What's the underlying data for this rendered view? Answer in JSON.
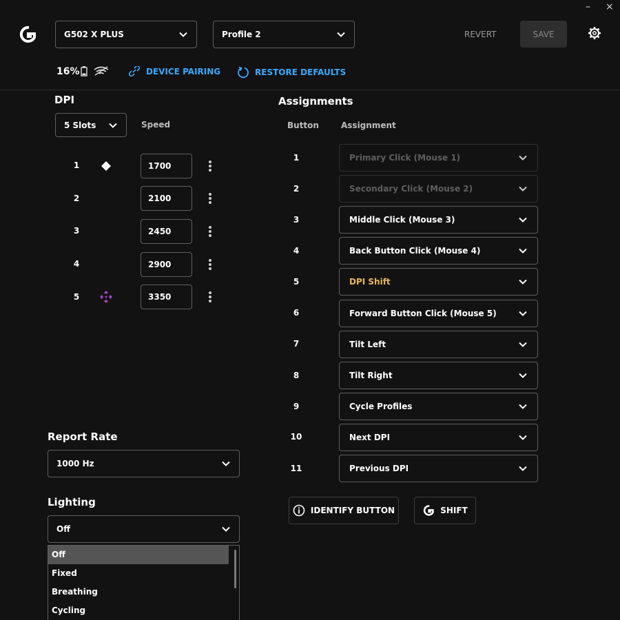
{
  "window": {
    "minimize_label": "–",
    "close_label": "×"
  },
  "header": {
    "device_name": "G502 X PLUS",
    "profile_name": "Profile 2",
    "revert_label": "REVERT",
    "save_label": "SAVE"
  },
  "status": {
    "battery_percent": "16%",
    "device_pairing_label": "DEVICE PAIRING",
    "restore_defaults_label": "RESTORE DEFAULTS"
  },
  "dpi": {
    "title": "DPI",
    "slots_label": "5 Slots",
    "speed_header": "Speed",
    "slots": [
      {
        "num": "1",
        "value": "1700",
        "marker": "default-dpi-diamond-icon"
      },
      {
        "num": "2",
        "value": "2100"
      },
      {
        "num": "3",
        "value": "2450"
      },
      {
        "num": "4",
        "value": "2900"
      },
      {
        "num": "5",
        "value": "3350",
        "marker": "shift-dpi-icon"
      }
    ]
  },
  "assignments": {
    "title": "Assignments",
    "button_header": "Button",
    "assignment_header": "Assignment",
    "rows": [
      {
        "num": "1",
        "label": "Primary Click (Mouse 1)",
        "state": "disabled"
      },
      {
        "num": "2",
        "label": "Secondary Click (Mouse 2)",
        "state": "disabled"
      },
      {
        "num": "3",
        "label": "Middle Click (Mouse 3)"
      },
      {
        "num": "4",
        "label": "Back Button Click (Mouse 4)"
      },
      {
        "num": "5",
        "label": "DPI Shift",
        "state": "highlight"
      },
      {
        "num": "6",
        "label": "Forward Button Click (Mouse 5)"
      },
      {
        "num": "7",
        "label": "Tilt Left"
      },
      {
        "num": "8",
        "label": "Tilt Right"
      },
      {
        "num": "9",
        "label": "Cycle Profiles"
      },
      {
        "num": "10",
        "label": "Next DPI"
      },
      {
        "num": "11",
        "label": "Previous DPI"
      }
    ],
    "identify_label": "IDENTIFY BUTTON",
    "shift_label": "SHIFT"
  },
  "report_rate": {
    "title": "Report Rate",
    "value": "1000 Hz"
  },
  "lighting": {
    "title": "Lighting",
    "value": "Off",
    "options": [
      "Off",
      "Fixed",
      "Breathing",
      "Cycling"
    ]
  },
  "colors": {
    "background": "#121212",
    "accent_link": "#3da9ff",
    "shift_text": "#e8b85e",
    "shift_marker": "#b04ad6"
  }
}
